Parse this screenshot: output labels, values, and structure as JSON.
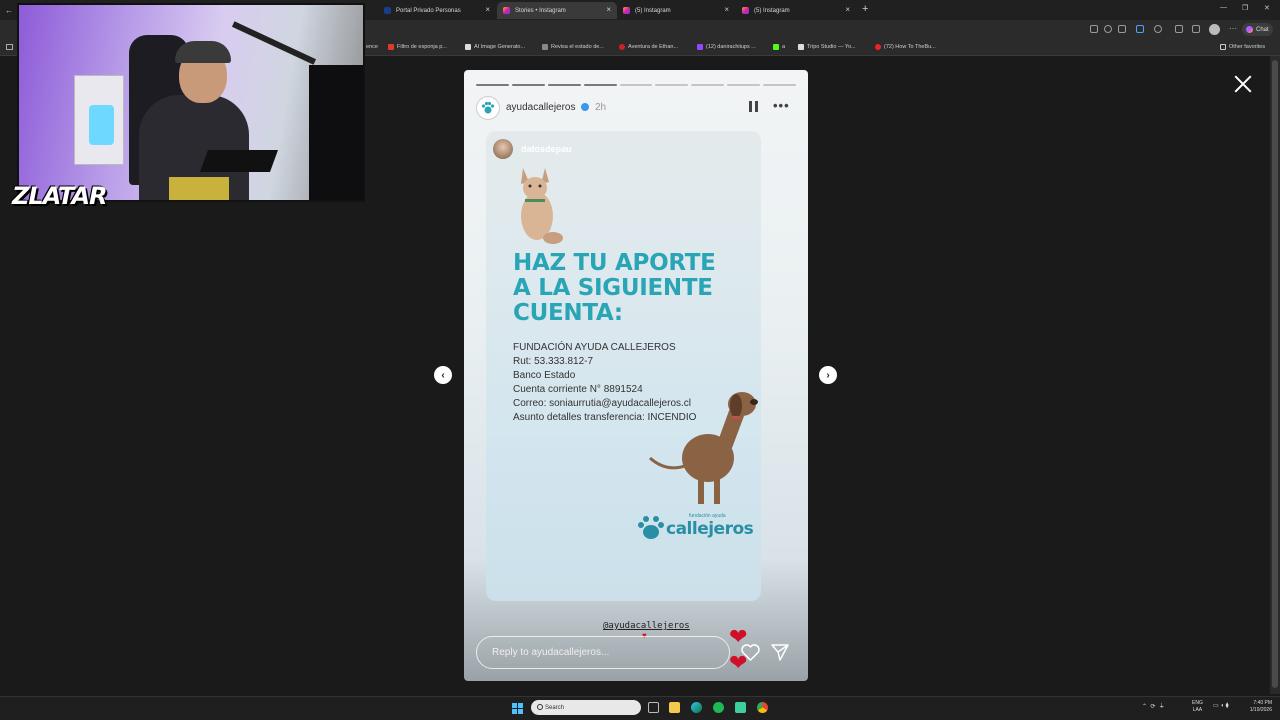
{
  "browser": {
    "tabs": [
      {
        "label": "Portal Privado Personas",
        "active": false
      },
      {
        "label": "Stories • Instagram",
        "active": true
      },
      {
        "label": "(5) Instagram",
        "active": false
      },
      {
        "label": "(5) Instagram",
        "active": false
      }
    ],
    "new_tab": "+",
    "chat_label": "Chat",
    "bookmarks": [
      "ence",
      "Filtro de esponja p...",
      "AI Image Generato...",
      "Revisa el estado de...",
      "Aventura de Ethan...",
      "(12) danirachiiups ...",
      "a",
      "Tripo Studio — Yo...",
      "(72) How To TheBu..."
    ],
    "other_favorites": "Other favorites"
  },
  "webcam": {
    "overlay_text": "ZLATAR"
  },
  "story": {
    "username": "ayudacallejeros",
    "time": "2h",
    "progress": {
      "total": 9,
      "completed": 4
    },
    "card": {
      "username": "datosdepau",
      "headline": [
        "HAZ TU APORTE",
        "A LA SIGUIENTE",
        "CUENTA:"
      ],
      "details": [
        "FUNDACIÓN AYUDA CALLEJEROS",
        "Rut: 53.333.812-7",
        "Banco Estado",
        "Cuenta corriente N° 8891524",
        "Correo: soniaurrutia@ayudacallejeros.cl",
        "Asunto detalles transferencia: INCENDIO"
      ],
      "logo_small": "fundación ayuda",
      "logo_text": "callejeros",
      "mention": "@ayudacallejeros"
    },
    "reply_placeholder": "Reply to ayudacallejeros..."
  },
  "taskbar": {
    "search_label": "Search",
    "lang_line1": "ENG",
    "lang_line2": "LAA",
    "time": "7:40 PM",
    "date": "1/19/2026"
  },
  "colors": {
    "headline": "#2aa5b5",
    "brand_teal": "#2a8fa5",
    "heart_red": "#d0102a"
  }
}
